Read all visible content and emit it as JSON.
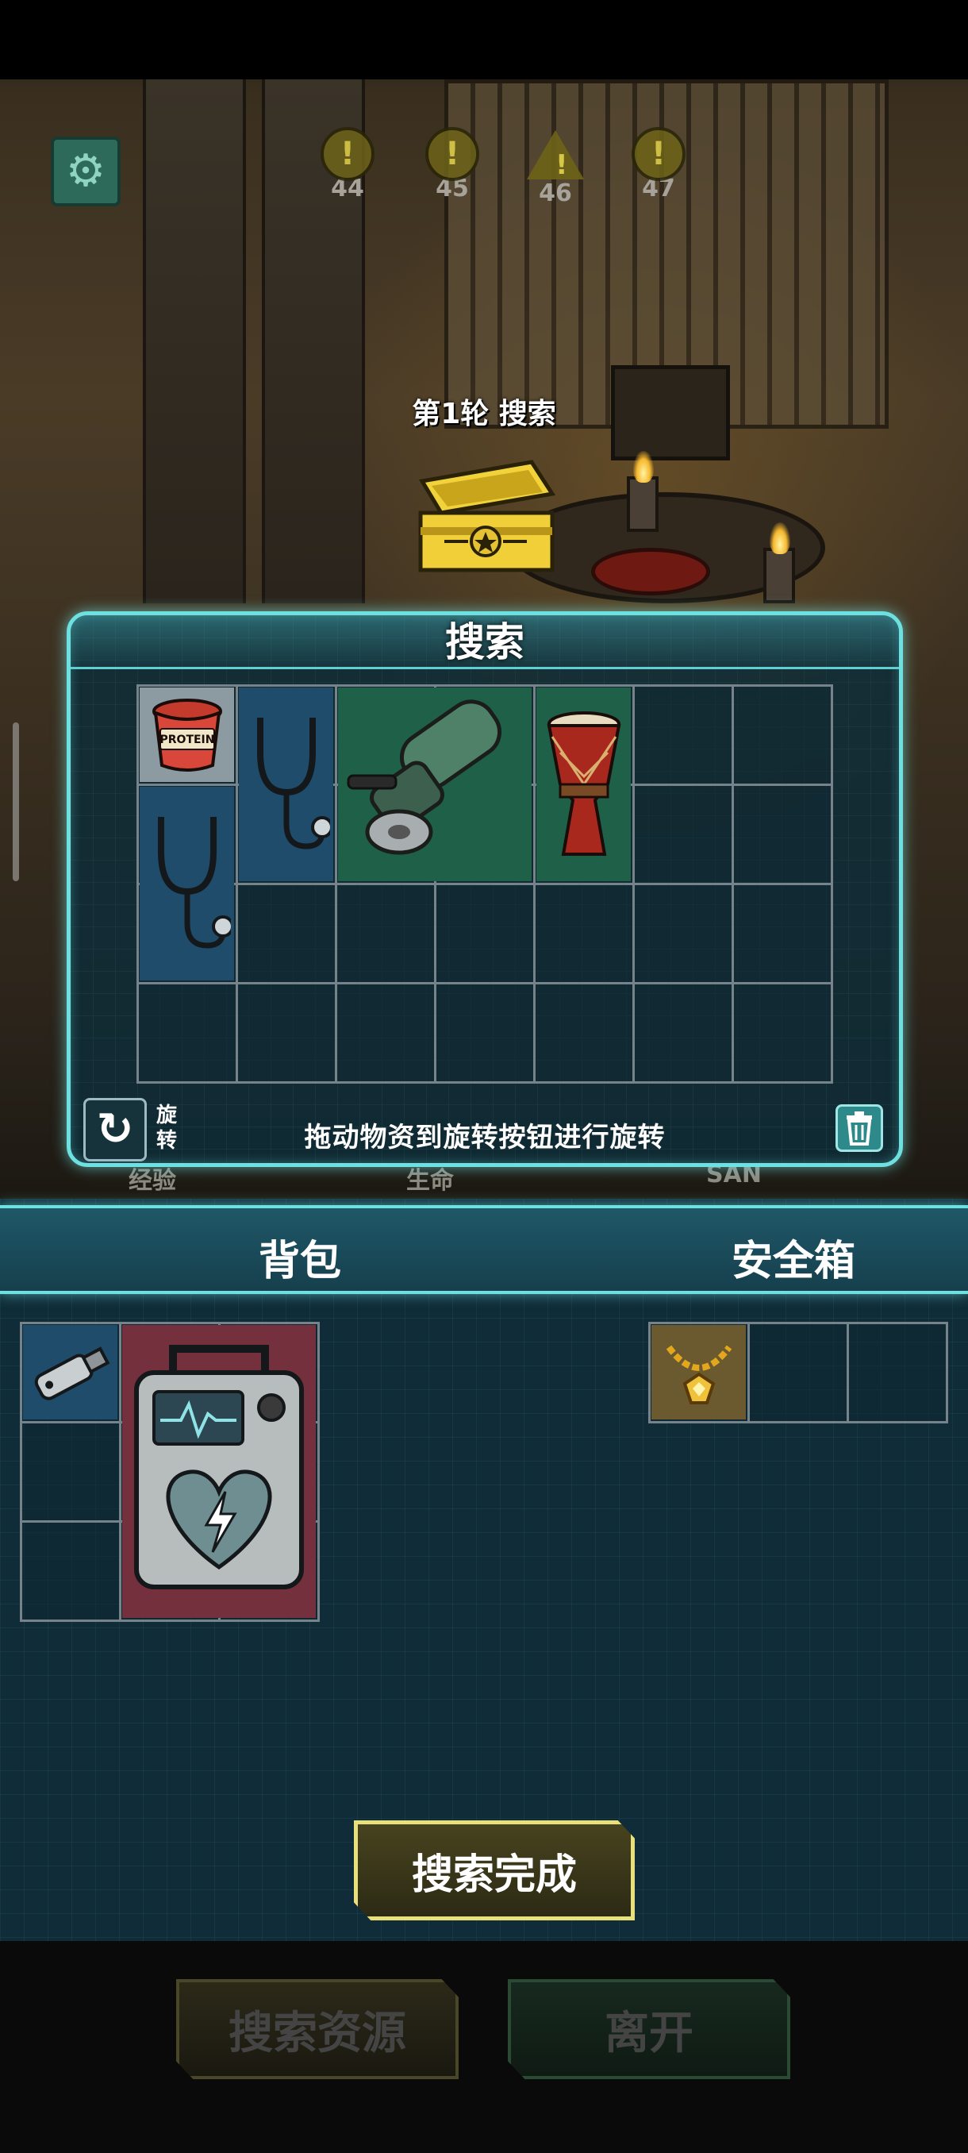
{
  "hud": {
    "levels": [
      {
        "number": "44",
        "kind": "exclaim"
      },
      {
        "number": "45",
        "kind": "exclaim"
      },
      {
        "number": "46",
        "kind": "warning"
      },
      {
        "number": "47",
        "kind": "exclaim"
      }
    ],
    "settings_icon": "gear-icon",
    "background_stats": [
      "经验",
      "生命",
      "SAN"
    ]
  },
  "round": {
    "title": "第1轮 搜索",
    "chest_icon": "treasure-chest-icon"
  },
  "search_panel": {
    "title": "搜索",
    "grid": {
      "columns": 7,
      "rows": 4
    },
    "items": [
      {
        "name": "protein-tub",
        "label": "PROTEIN",
        "rarity": "white"
      },
      {
        "name": "stethoscope",
        "rarity": "blue"
      },
      {
        "name": "stethoscope",
        "rarity": "blue"
      },
      {
        "name": "angle-grinder",
        "rarity": "green"
      },
      {
        "name": "djembe-drum",
        "rarity": "green"
      }
    ],
    "rotate_label": "旋转",
    "rotate_icon": "rotate-icon",
    "hint": "拖动物资到旋转按钮进行旋转",
    "trash_icon": "trash-icon"
  },
  "inventory": {
    "backpack_title": "背包",
    "safebox_title": "安全箱",
    "backpack_grid": {
      "columns": 3,
      "rows": 3
    },
    "backpack_items": [
      {
        "name": "usb-drive",
        "rarity": "blue"
      },
      {
        "name": "defibrillator",
        "rarity": "red"
      }
    ],
    "safebox_grid": {
      "columns": 3,
      "rows": 1
    },
    "safebox_items": [
      {
        "name": "gold-necklace",
        "rarity": "gold"
      }
    ]
  },
  "actions": {
    "search_complete": "搜索完成",
    "search_resource": "搜索资源",
    "leave": "离开"
  },
  "colors": {
    "panel_border": "#6ee0e0",
    "panel_bg": "#0e2c38",
    "rarity_white": "#8c9aa2",
    "rarity_blue": "#1f4c6a",
    "rarity_green": "#1e6148",
    "rarity_red": "#74303d",
    "rarity_gold": "#6b5a2f",
    "complete_button_border": "#e8e07a"
  }
}
